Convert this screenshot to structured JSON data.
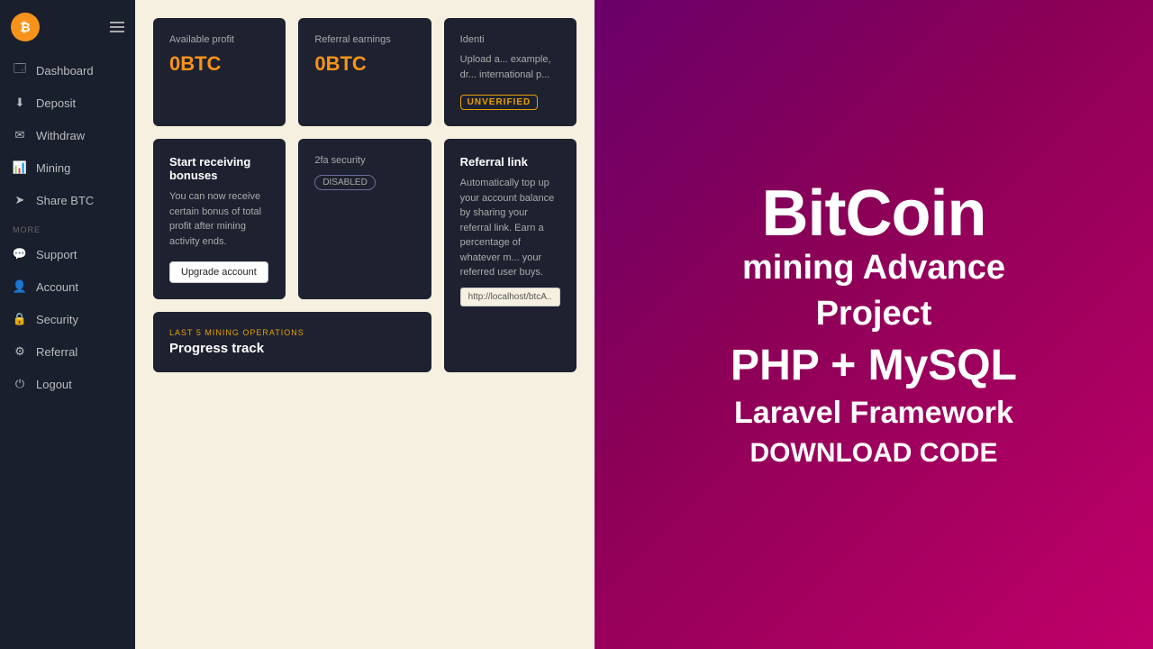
{
  "sidebar": {
    "logo_letter": "₿",
    "nav_main": [
      {
        "label": "Dashboard",
        "icon": "🗔",
        "name": "dashboard"
      },
      {
        "label": "Deposit",
        "icon": "⬇",
        "name": "deposit"
      },
      {
        "label": "Withdraw",
        "icon": "✉",
        "name": "withdraw"
      },
      {
        "label": "Mining",
        "icon": "📊",
        "name": "mining"
      },
      {
        "label": "Share BTC",
        "icon": "➤",
        "name": "share-btc"
      }
    ],
    "more_label": "MORE",
    "nav_more": [
      {
        "label": "Support",
        "icon": "💬",
        "name": "support"
      },
      {
        "label": "Account",
        "icon": "👤",
        "name": "account"
      },
      {
        "label": "Security",
        "icon": "🔒",
        "name": "security"
      },
      {
        "label": "Referral",
        "icon": "⚙",
        "name": "referral"
      },
      {
        "label": "Logout",
        "icon": "⏻",
        "name": "logout"
      }
    ]
  },
  "cards": {
    "available_profit": {
      "label": "Available profit",
      "value": "0BTC"
    },
    "referral_earnings": {
      "label": "Referral earnings",
      "value": "0BTC"
    },
    "identity": {
      "title": "Identi",
      "desc": "Upload a... example, dr... international p...",
      "badge": "UNVERIFIED"
    },
    "bonuses": {
      "title": "Start receiving bonuses",
      "desc": "You can now receive certain bonus of total profit after mining activity ends.",
      "button": "Upgrade account"
    },
    "security_2fa": {
      "title": "2fa security",
      "badge": "DISABLED"
    },
    "mining_ops": {
      "sublabel": "LAST 5 MINING OPERATIONS",
      "title": "Progress track"
    },
    "referral_link": {
      "title": "Referral link",
      "desc": "Automatically top up your account balance by sharing your referral link. Earn a percentage of whatever m... your referred user buys.",
      "input_value": "http://localhost/btcA..."
    }
  },
  "promo": {
    "line1": "BitCoin",
    "line2": "mining Advance",
    "line3": "Project",
    "line4": "PHP + MySQL",
    "line5": "Laravel Framework",
    "line6": "DOWNLOAD CODE"
  }
}
